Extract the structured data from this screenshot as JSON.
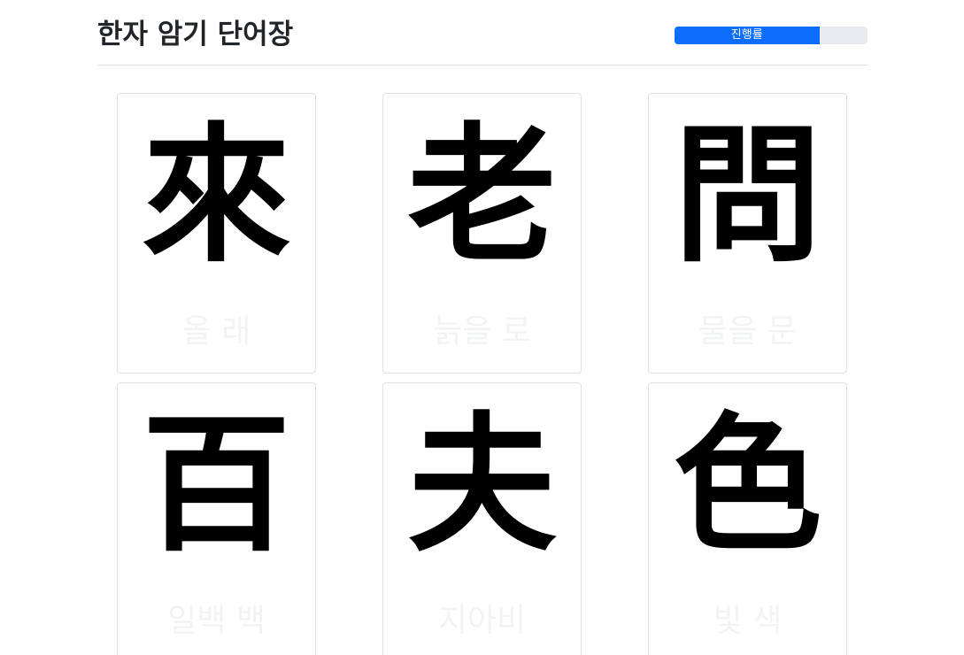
{
  "header": {
    "title": "한자 암기 단어장",
    "progress_label": "진행률",
    "progress_fraction": 0.75
  },
  "colors": {
    "accent": "#0d6efd",
    "track": "#e9ecef",
    "card_border": "#dee2e6",
    "meaning_text": "#f1f3f5"
  },
  "cards": [
    {
      "hanja": "來",
      "meaning": "올 래"
    },
    {
      "hanja": "老",
      "meaning": "늙을 로"
    },
    {
      "hanja": "問",
      "meaning": "물을 문"
    },
    {
      "hanja": "百",
      "meaning": "일백 백"
    },
    {
      "hanja": "夫",
      "meaning": "지아비"
    },
    {
      "hanja": "色",
      "meaning": "빛 색"
    }
  ]
}
